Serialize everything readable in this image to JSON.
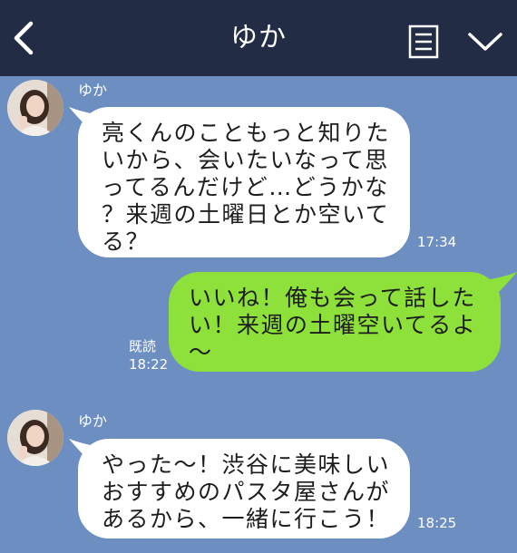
{
  "header": {
    "title": "ゆか",
    "back_icon": "chevron-left-icon",
    "menu_icon": "notes-icon",
    "dropdown_icon": "chevron-down-icon"
  },
  "colors": {
    "header_bg": "#232c45",
    "chat_bg": "#6d8ec0",
    "incoming_bubble": "#ffffff",
    "outgoing_bubble": "#8ee03a"
  },
  "messages": [
    {
      "direction": "incoming",
      "sender": "ゆか",
      "lines": [
        "亮くんのこともっと知りた",
        "いから、会いたいなって思",
        "ってるんだけど…どうかな",
        "？来週の土曜日とか空いて",
        "る？"
      ],
      "time": "17:34"
    },
    {
      "direction": "outgoing",
      "read_label": "既読",
      "lines": [
        "いいね！俺も会って話した",
        "い！来週の土曜空いてるよ",
        "〜"
      ],
      "time": "18:22"
    },
    {
      "direction": "incoming",
      "sender": "ゆか",
      "lines": [
        "やった〜！渋谷に美味しい",
        "おすすめのパスタ屋さんが",
        "あるから、一緒に行こう！"
      ],
      "time": "18:25"
    }
  ]
}
